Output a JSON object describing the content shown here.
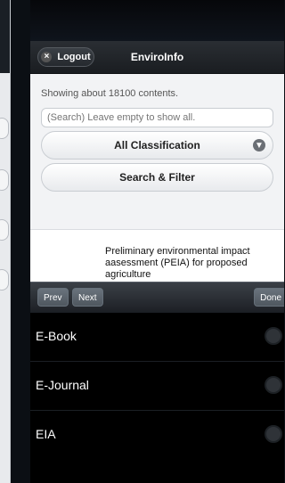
{
  "header": {
    "logout_label": "Logout",
    "title": "EnviroInfo"
  },
  "search": {
    "showing_text": "Showing about 18100 contents.",
    "placeholder": "(Search) Leave empty to show all.",
    "classification_selected": "All Classification",
    "filter_button": "Search & Filter"
  },
  "result": {
    "title": "Preliminary environmental impact aasessment (PEIA) for proposed agriculture"
  },
  "keyboard": {
    "prev": "Prev",
    "next": "Next",
    "done": "Done"
  },
  "picker": {
    "options": [
      "E-Book",
      "E-Journal",
      "EIA"
    ]
  },
  "colors": {
    "header_bg": "#1f2328",
    "picker_bg": "#000000",
    "screen_bg": "#f2f3f5"
  },
  "icons": {
    "logout": "close-icon",
    "dropdown": "chevron-down-icon",
    "option_radio": "radio-icon"
  }
}
